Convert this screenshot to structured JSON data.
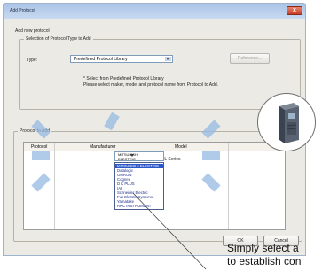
{
  "window": {
    "title": "Add Protocol",
    "close_glyph": "x"
  },
  "heading": "Add new protocol",
  "selection_group": {
    "title": "Selection of Protocol Type to Add",
    "type_label": "Type:",
    "type_value": "Predefined Protocol Library",
    "reference_button": "Reference...",
    "note_line1": "* Select from Predefined Protocol Library",
    "note_line2": "Please select maker, model and protocol name from Protocol to Add."
  },
  "protocol_group": {
    "title": "Protocol to Add",
    "columns": [
      "Protocol",
      "Manufacturer",
      "Model"
    ],
    "manufacturer_value": "MITSUBISHI ELECTRIC",
    "model_value": "FREQROL Series",
    "dropdown_items": [
      "MITSUBISHI ELECTRIC",
      "Datalogic",
      "OMRON",
      "Cognex",
      "D K PLUS",
      "IAI",
      "Schneider Electric",
      "Fuji Electric Systems",
      "Yamatake",
      "RKC INSTRUMENT"
    ],
    "selected_index": 0
  },
  "buttons": {
    "ok": "OK",
    "cancel": "Cancel"
  },
  "annotation": {
    "line1": "Simply select a",
    "line2": "to establish con"
  },
  "colors": {
    "titlebar": "#a9c3e6",
    "selection_highlight": "#2d58c9",
    "beam": "#96b9e1"
  },
  "icons": [
    "close-icon",
    "dropdown-arrow-icon",
    "inverter-device-icon"
  ]
}
